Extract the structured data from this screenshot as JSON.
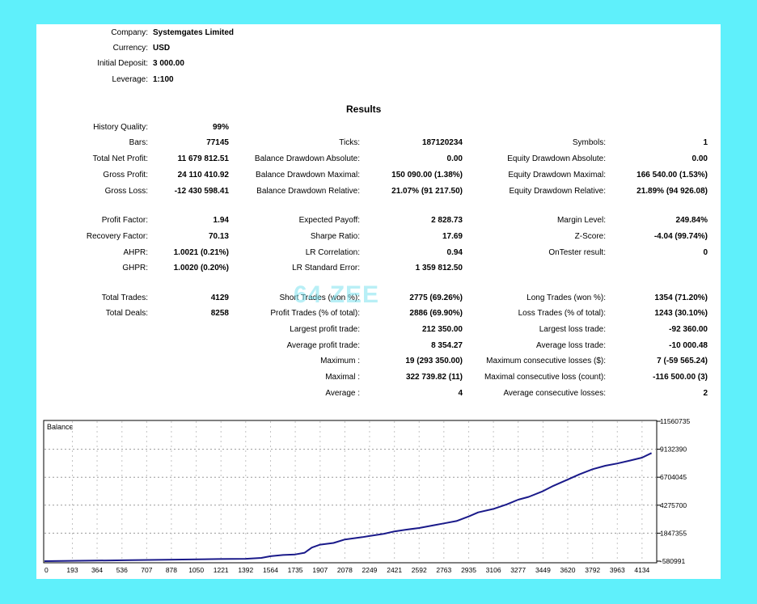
{
  "header": {
    "company_label": "Company:",
    "company": "Systemgates Limited",
    "currency_label": "Currency:",
    "currency": "USD",
    "deposit_label": "Initial Deposit:",
    "deposit": "3 000.00",
    "leverage_label": "Leverage:",
    "leverage": "1:100"
  },
  "results_title": "Results",
  "col1": [
    {
      "label": "History Quality:",
      "value": "99%"
    },
    {
      "label": "Bars:",
      "value": "77145"
    },
    {
      "label": "Total Net Profit:",
      "value": "11 679 812.51"
    },
    {
      "label": "Gross Profit:",
      "value": "24 110 410.92"
    },
    {
      "label": "Gross Loss:",
      "value": "-12 430 598.41"
    },
    {
      "label": "Profit Factor:",
      "value": "1.94"
    },
    {
      "label": "Recovery Factor:",
      "value": "70.13"
    },
    {
      "label": "AHPR:",
      "value": "1.0021 (0.21%)"
    },
    {
      "label": "GHPR:",
      "value": "1.0020 (0.20%)"
    },
    {
      "label": "Total Trades:",
      "value": "4129"
    },
    {
      "label": "Total Deals:",
      "value": "8258"
    }
  ],
  "col2": [
    {
      "label": "Ticks:",
      "value": "187120234"
    },
    {
      "label": "Balance Drawdown Absolute:",
      "value": "0.00"
    },
    {
      "label": "Balance Drawdown Maximal:",
      "value": "150 090.00 (1.38%)"
    },
    {
      "label": "Balance Drawdown Relative:",
      "value": "21.07% (91 217.50)"
    },
    {
      "label": "Expected Payoff:",
      "value": "2 828.73"
    },
    {
      "label": "Sharpe Ratio:",
      "value": "17.69"
    },
    {
      "label": "LR Correlation:",
      "value": "0.94"
    },
    {
      "label": "LR Standard Error:",
      "value": "1 359 812.50"
    },
    {
      "label": "Short Trades (won %):",
      "value": "2775 (69.26%)"
    },
    {
      "label": "Profit Trades (% of total):",
      "value": "2886 (69.90%)"
    },
    {
      "label": "Largest profit trade:",
      "value": "212 350.00"
    },
    {
      "label": "Average profit trade:",
      "value": "8 354.27"
    },
    {
      "label": "Maximum :",
      "value": "19 (293 350.00)"
    },
    {
      "label": "Maximal :",
      "value": "322 739.82 (11)"
    },
    {
      "label": "Average :",
      "value": "4"
    }
  ],
  "col3": [
    {
      "label": "Symbols:",
      "value": "1"
    },
    {
      "label": "Equity Drawdown Absolute:",
      "value": "0.00"
    },
    {
      "label": "Equity Drawdown Maximal:",
      "value": "166 540.00 (1.53%)"
    },
    {
      "label": "Equity Drawdown Relative:",
      "value": "21.89% (94 926.08)"
    },
    {
      "label": "Margin Level:",
      "value": "249.84%"
    },
    {
      "label": "Z-Score:",
      "value": "-4.04 (99.74%)"
    },
    {
      "label": "OnTester result:",
      "value": "0"
    },
    {
      "label": "Long Trades (won %):",
      "value": "1354 (71.20%)"
    },
    {
      "label": "Loss Trades (% of total):",
      "value": "1243 (30.10%)"
    },
    {
      "label": "Largest loss trade:",
      "value": "-92 360.00"
    },
    {
      "label": "Average loss trade:",
      "value": "-10 000.48"
    },
    {
      "label": "Maximum consecutive losses ($):",
      "value": "7 (-59 565.24)"
    },
    {
      "label": "Maximal consecutive loss (count):",
      "value": "-116 500.00 (3)"
    },
    {
      "label": "Average consecutive losses:",
      "value": "2"
    }
  ],
  "watermark": "64 ZEE",
  "chart_data": {
    "type": "line",
    "title": "Balance",
    "x_ticks": [
      0,
      193,
      364,
      536,
      707,
      878,
      1050,
      1221,
      1392,
      1564,
      1735,
      1907,
      2078,
      2249,
      2421,
      2592,
      2763,
      2935,
      3106,
      3277,
      3449,
      3620,
      3792,
      3963,
      4134
    ],
    "y_ticks": [
      11560735,
      9132390,
      6704045,
      4275700,
      1847355,
      -580991
    ],
    "xlim": [
      0,
      4230
    ],
    "ylim": [
      -580991,
      11560735
    ],
    "series": [
      {
        "color": "#1a1a8a",
        "x": [
          0,
          300,
          600,
          900,
          1200,
          1392,
          1500,
          1564,
          1650,
          1735,
          1800,
          1850,
          1907,
          2000,
          2078,
          2200,
          2249,
          2350,
          2421,
          2500,
          2592,
          2700,
          2763,
          2850,
          2935,
          3000,
          3106,
          3200,
          3277,
          3350,
          3449,
          3520,
          3620,
          3700,
          3792,
          3880,
          3963,
          4050,
          4134,
          4200
        ],
        "y": [
          -580991,
          -540000,
          -500000,
          -450000,
          -400000,
          -380000,
          -300000,
          -150000,
          -50000,
          0,
          150000,
          600000,
          850000,
          1000000,
          1300000,
          1500000,
          1600000,
          1800000,
          2000000,
          2150000,
          2300000,
          2550000,
          2700000,
          2900000,
          3300000,
          3650000,
          3950000,
          4350000,
          4750000,
          5000000,
          5500000,
          5950000,
          6500000,
          6950000,
          7400000,
          7700000,
          7900000,
          8150000,
          8400000,
          8800000
        ]
      }
    ]
  }
}
